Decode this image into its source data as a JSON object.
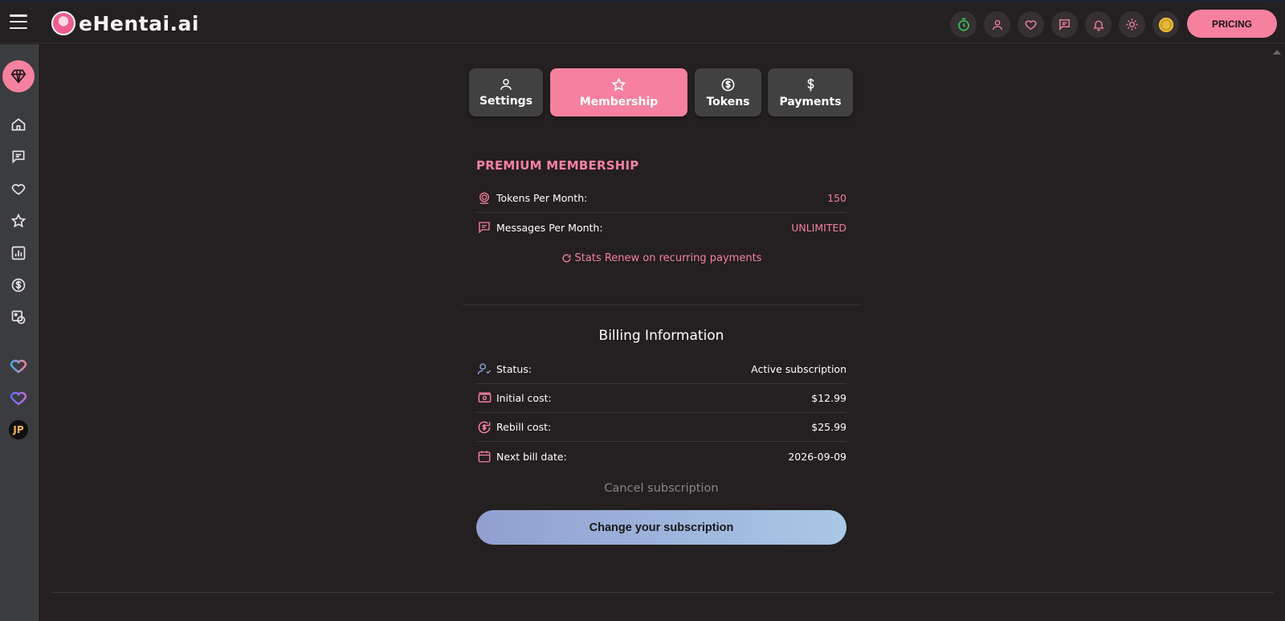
{
  "header": {
    "logo_text": "eHentai.ai",
    "pricing_label": "PRICING",
    "icons": [
      "timer-icon",
      "user-icon",
      "heart-icon",
      "chat-icon",
      "bell-icon",
      "sun-icon",
      "coin-icon"
    ]
  },
  "sidebar": {
    "items": [
      "diamond-icon",
      "home-icon",
      "chat-icon",
      "heart-icon",
      "star-icon",
      "chart-icon",
      "dollar-icon",
      "gallery-icon",
      "heart-chat-icon",
      "heart-gradient-icon",
      "jp-badge"
    ],
    "jp_label": "JP"
  },
  "tabs": [
    {
      "label": "Settings",
      "icon": "user-icon"
    },
    {
      "label": "Membership",
      "icon": "star-icon",
      "active": true
    },
    {
      "label": "Tokens",
      "icon": "dollar-circle-icon"
    },
    {
      "label": "Payments",
      "icon": "dollar-icon"
    }
  ],
  "membership": {
    "title": "PREMIUM MEMBERSHIP",
    "tokens_label": "Tokens Per Month:",
    "tokens_value": "150",
    "messages_label": "Messages Per Month:",
    "messages_value": "UNLIMITED",
    "renew_text": "Stats Renew on recurring payments"
  },
  "billing": {
    "title": "Billing Information",
    "status_label": "Status:",
    "status_value": "Active subscription",
    "initial_label": "Initial cost:",
    "initial_value": "$12.99",
    "rebill_label": "Rebill cost:",
    "rebill_value": "$25.99",
    "next_label": "Next bill date:",
    "next_value": "2026-09-09",
    "cancel_label": "Cancel subscription",
    "change_label": "Change your subscription"
  },
  "colors": {
    "accent_pink": "#f5819f",
    "background": "#241f20",
    "sidebar": "#3b3c3f",
    "button_gradient_start": "#919fd0",
    "button_gradient_end": "#a8c8e6"
  }
}
